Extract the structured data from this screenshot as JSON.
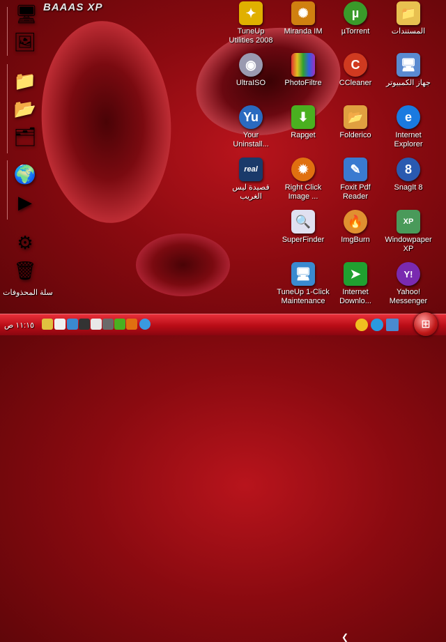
{
  "brand": "BAAAS XP",
  "sidebar": {
    "recycle_label": "سلة المحذوفات",
    "icons": [
      "computer-icon",
      "control-panel-icon",
      "folder-icon",
      "documents-icon",
      "pictures-icon",
      "globe-icon",
      "media-player-icon",
      "settings-gears-icon",
      "recycle-bin-icon"
    ]
  },
  "desktop": {
    "icons": [
      {
        "label": "TuneUp Utilities 2008",
        "icon": "tuneup-icon",
        "color": "#e0b000"
      },
      {
        "label": "Miranda IM",
        "icon": "miranda-icon",
        "color": "#d08010"
      },
      {
        "label": "µTorrent",
        "icon": "utorrent-icon",
        "color": "#3a9a2a"
      },
      {
        "label": "المستندات",
        "icon": "my-documents-icon",
        "color": "#e8c050"
      },
      {
        "label": "UltraISO",
        "icon": "ultraiso-icon",
        "color": "#9a9ab0"
      },
      {
        "label": "PhotoFiltre",
        "icon": "photofiltre-icon",
        "color": "#3a8ad0"
      },
      {
        "label": "CCleaner",
        "icon": "ccleaner-icon",
        "color": "#d03a20"
      },
      {
        "label": "جهاز الكمبيوتر",
        "icon": "my-computer-icon",
        "color": "#5a8ad0"
      },
      {
        "label": "Your Uninstall...",
        "icon": "uninstaller-icon",
        "color": "#2a6ac0"
      },
      {
        "label": "Rapget",
        "icon": "rapget-icon",
        "color": "#4ab020"
      },
      {
        "label": "Folderico",
        "icon": "folderico-icon",
        "color": "#e0a040"
      },
      {
        "label": "Internet Explorer",
        "icon": "internet-explorer-icon",
        "color": "#1a7ae0"
      },
      {
        "label": "قصيدة ليس الغريب",
        "icon": "real-player-icon",
        "color": "#1a3a6a"
      },
      {
        "label": "Right Click Image ...",
        "icon": "right-click-image-icon",
        "color": "#e07010"
      },
      {
        "label": "Foxit Pdf Reader",
        "icon": "foxit-icon",
        "color": "#3a7ad0"
      },
      {
        "label": "SnagIt 8",
        "icon": "snagit-icon",
        "color": "#2a5ab0"
      },
      {
        "label": "SuperFinder",
        "icon": "superfinder-icon",
        "color": "#e0e0f0"
      },
      {
        "label": "ImgBurn",
        "icon": "imgburn-icon",
        "color": "#e09030"
      },
      {
        "label": "Windowpaper XP",
        "icon": "windowpaper-icon",
        "color": "#4a9a5a"
      },
      {
        "label": "TuneUp 1-Click Maintenance",
        "icon": "tuneup-maintenance-icon",
        "color": "#3a8ad0"
      },
      {
        "label": "Internet Downlo...",
        "icon": "idm-icon",
        "color": "#20a030"
      },
      {
        "label": "Yahoo! Messenger",
        "icon": "yahoo-messenger-icon",
        "color": "#7a2ab0"
      }
    ]
  },
  "taskbar": {
    "clock": "١١:١٥ ص",
    "quicklaunch": [
      "ql-1",
      "ql-2",
      "ql-3",
      "ql-4",
      "ql-5",
      "ql-6",
      "ql-7",
      "ql-8",
      "ql-9",
      "ql-10",
      "ql-11",
      "ql-12"
    ],
    "tray": [
      "messenger-smiley-icon",
      "skype-icon",
      "network-icon"
    ]
  }
}
